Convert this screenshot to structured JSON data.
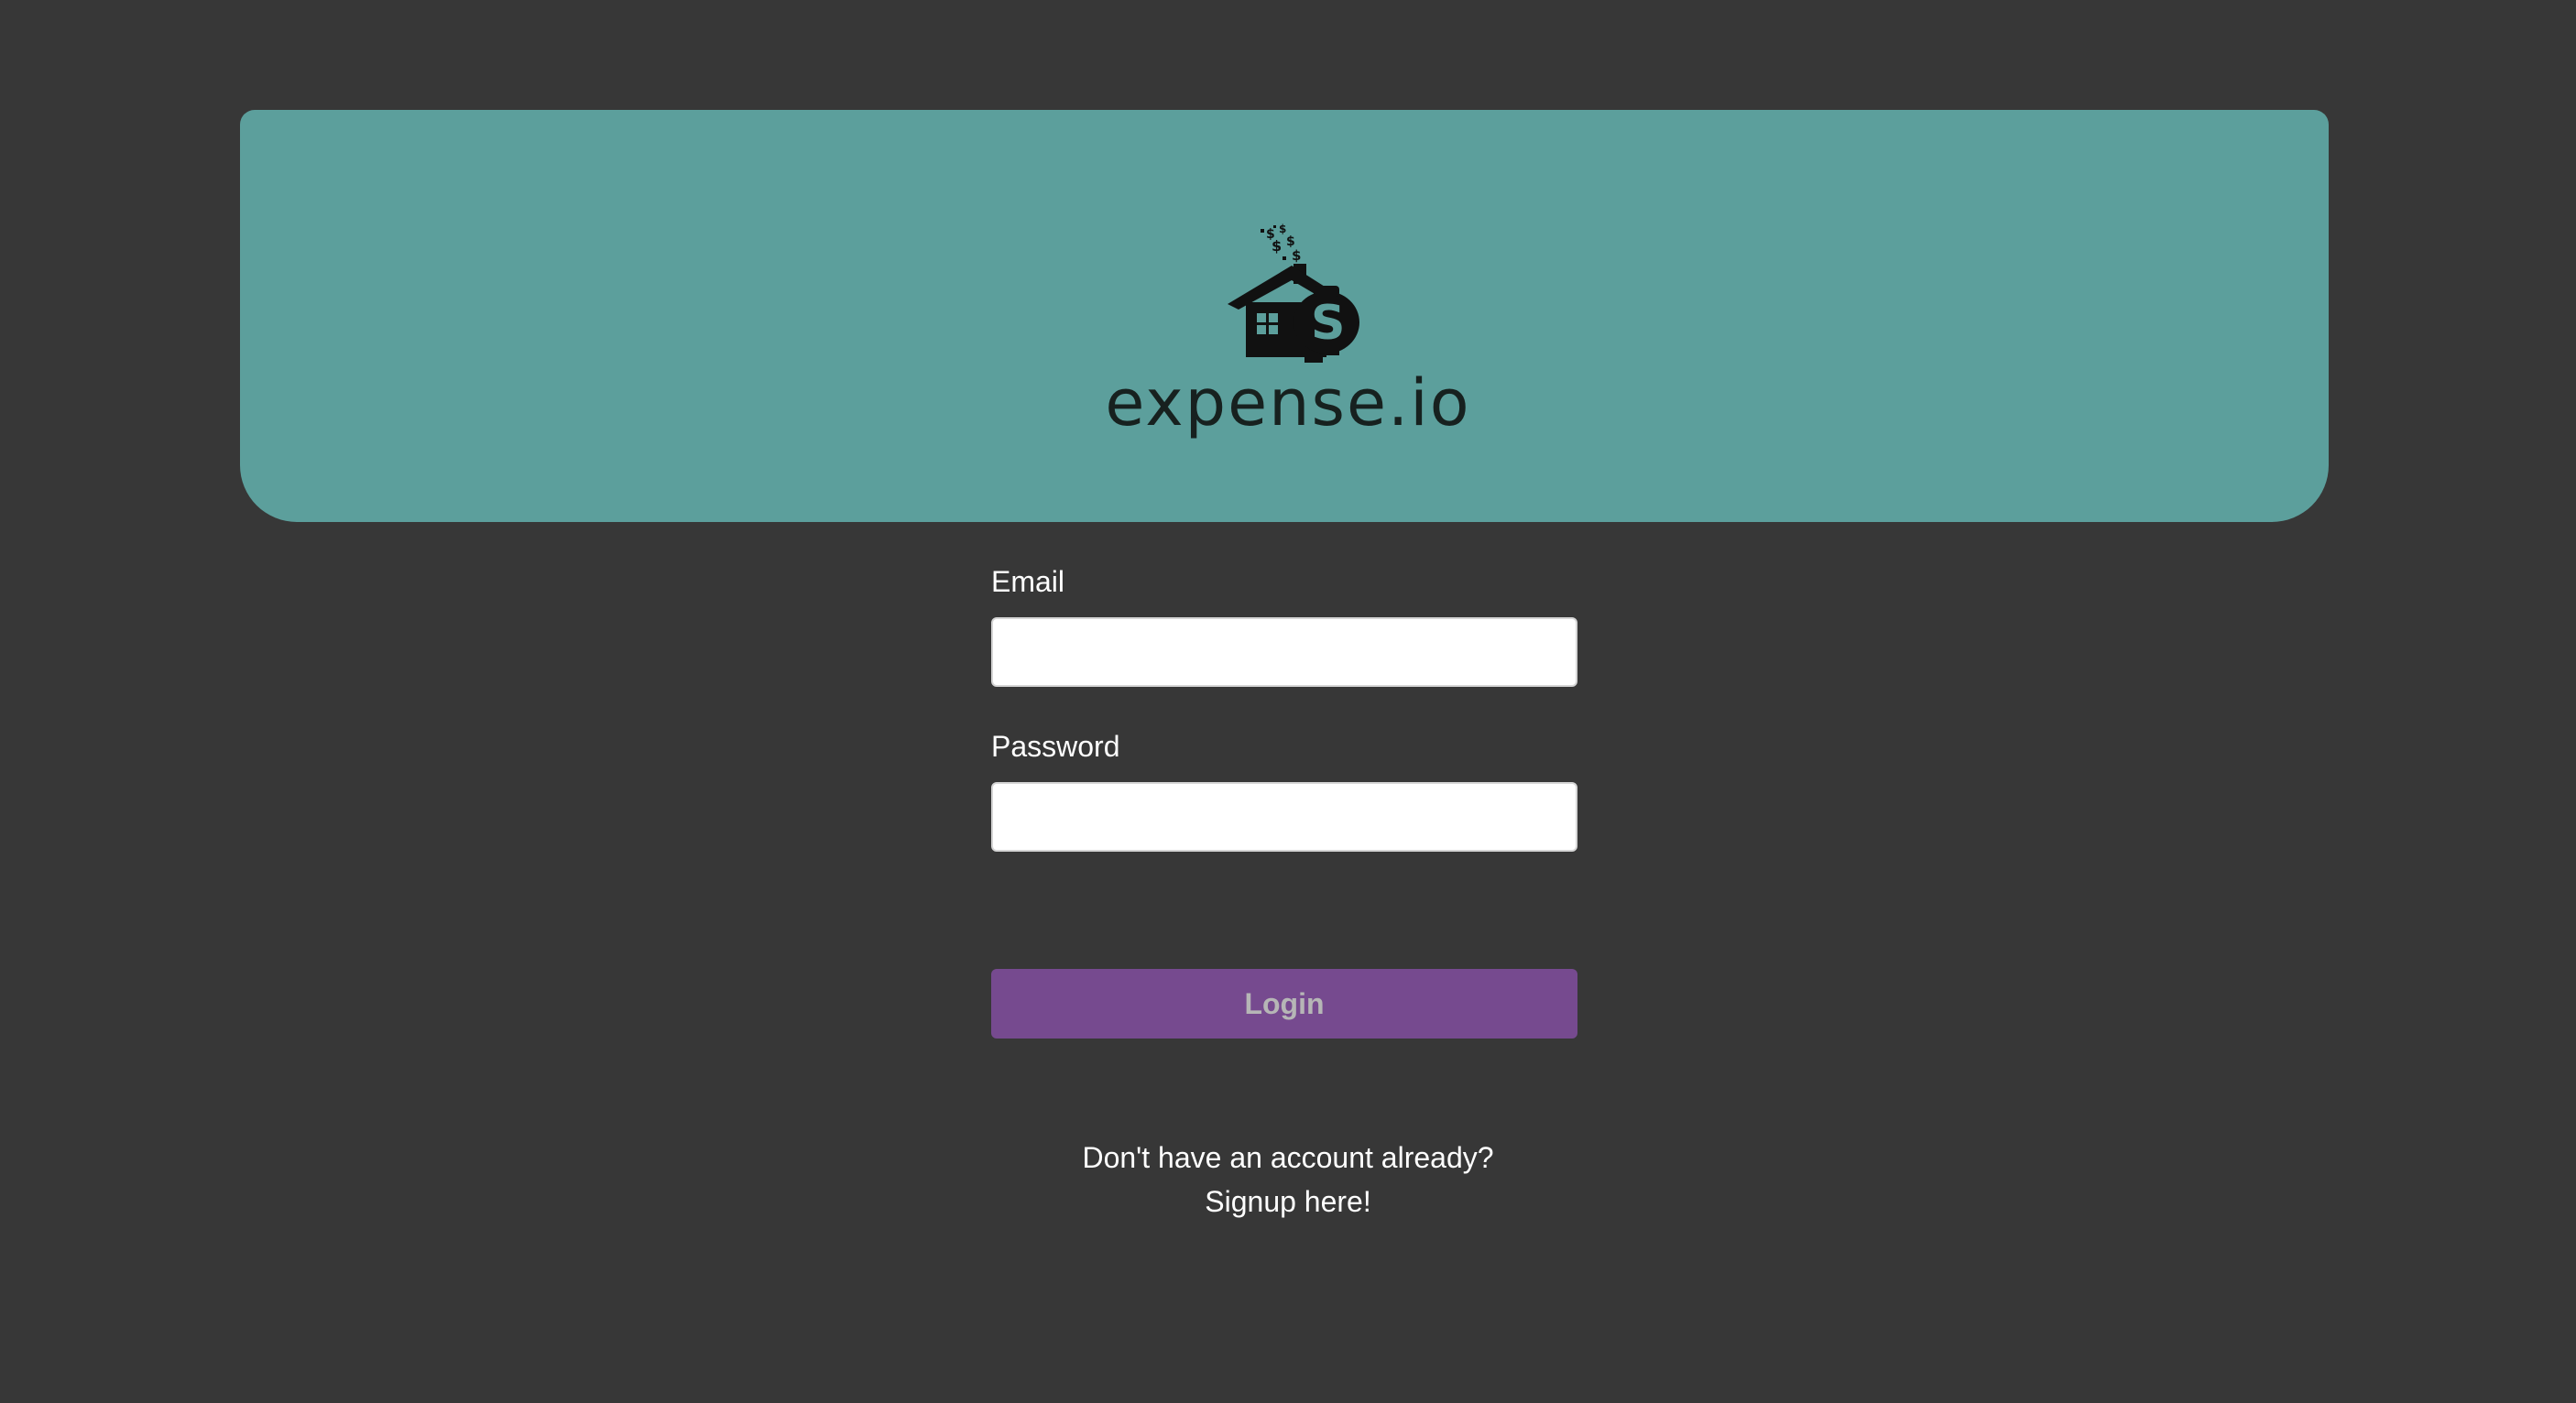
{
  "header": {
    "logo_icon": "house-money-icon",
    "brand_name": "expense.io",
    "background_color": "#5c9f9c"
  },
  "login_form": {
    "email_label": "Email",
    "email_value": "",
    "password_label": "Password",
    "password_value": "",
    "login_label": "Login",
    "login_color": "#764a8f"
  },
  "signup": {
    "prompt": "Don't have an account already?",
    "link_text": "Signup here!"
  },
  "page": {
    "background_color": "#373737"
  }
}
